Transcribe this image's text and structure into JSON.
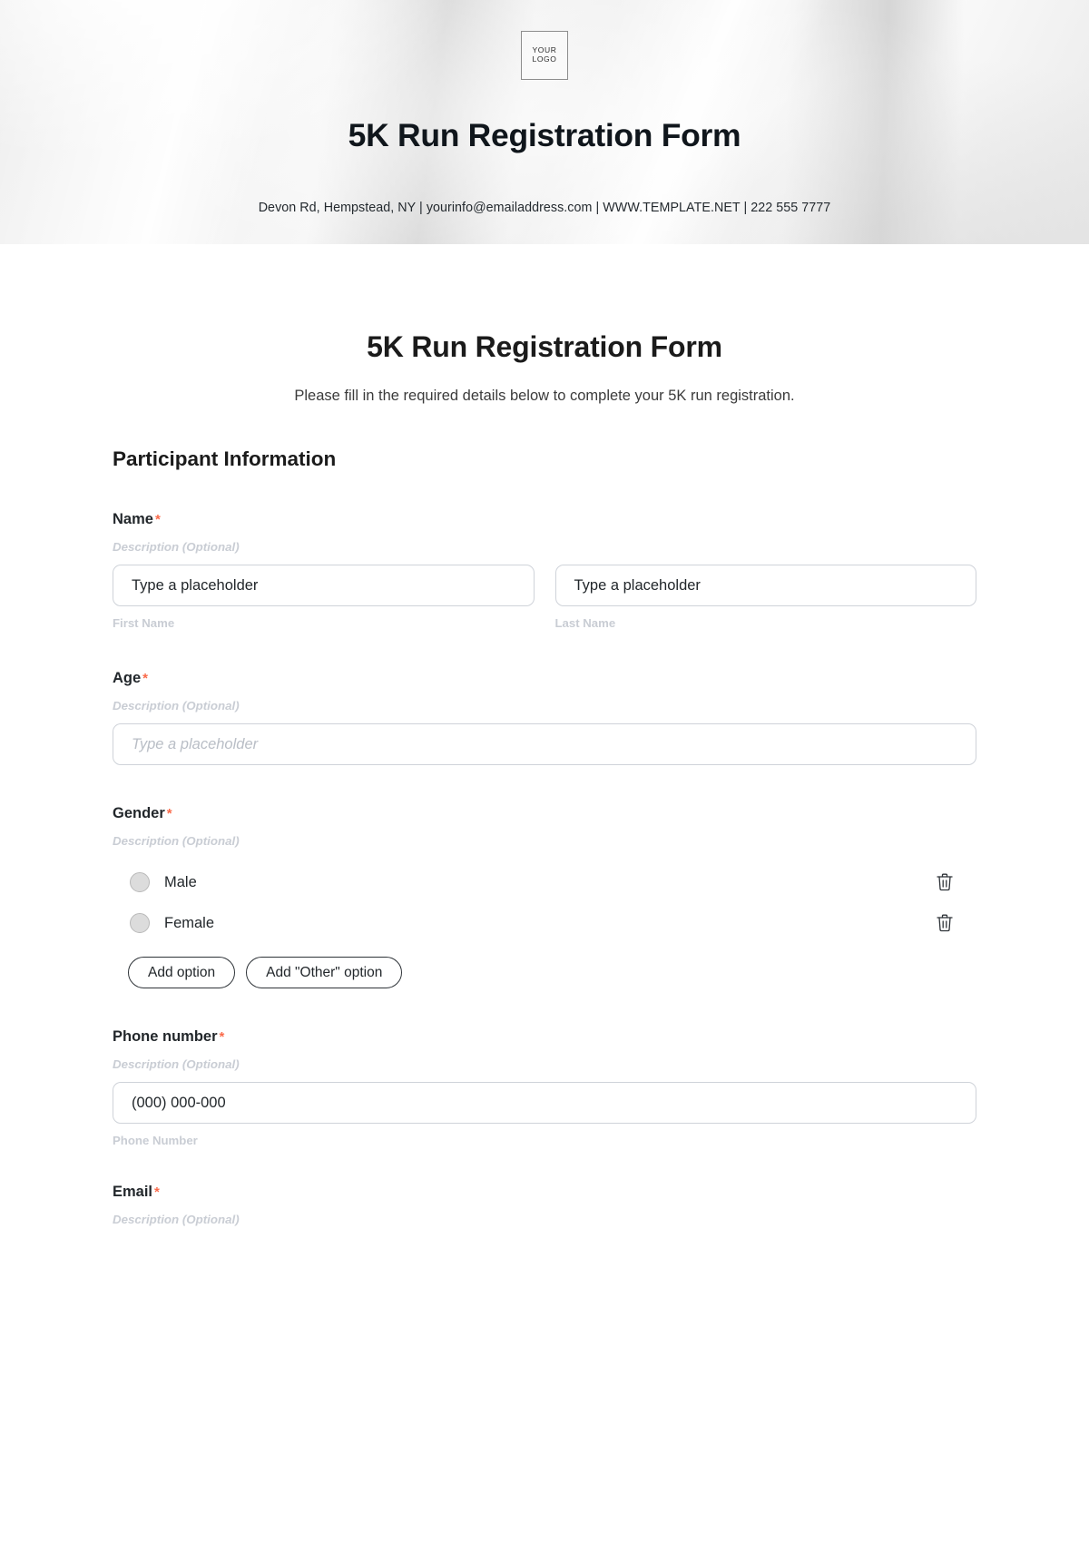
{
  "banner": {
    "logo_line1": "YOUR",
    "logo_line2": "LOGO",
    "title": "5K Run Registration Form",
    "contact": "Devon Rd, Hempstead, NY | yourinfo@emailaddress.com | WWW.TEMPLATE.NET | 222 555 7777"
  },
  "form": {
    "title": "5K Run Registration Form",
    "subtitle": "Please fill in the required details below to complete your 5K run registration.",
    "section_heading": "Participant Information",
    "required_mark": "*",
    "description_placeholder": "Description (Optional)",
    "fields": {
      "name": {
        "label": "Name",
        "description": "Description (Optional)",
        "first_placeholder": "Type a placeholder",
        "last_placeholder": "Type a placeholder",
        "first_sub_label": "First Name",
        "last_sub_label": "Last Name"
      },
      "age": {
        "label": "Age",
        "description": "Description (Optional)",
        "placeholder": "Type a placeholder"
      },
      "gender": {
        "label": "Gender",
        "description": "Description (Optional)",
        "options": [
          {
            "label": "Male"
          },
          {
            "label": "Female"
          }
        ],
        "add_option_label": "Add option",
        "add_other_label": "Add \"Other\" option"
      },
      "phone": {
        "label": "Phone number",
        "description": "Description (Optional)",
        "value": "(000) 000-000",
        "sub_label": "Phone Number"
      },
      "email": {
        "label": "Email",
        "description": "Description (Optional)"
      }
    }
  },
  "colors": {
    "required_accent": "#fa6a4a",
    "text_primary": "#1b1b1b",
    "muted": "#c9cdd4",
    "border": "#cfd3d9"
  }
}
